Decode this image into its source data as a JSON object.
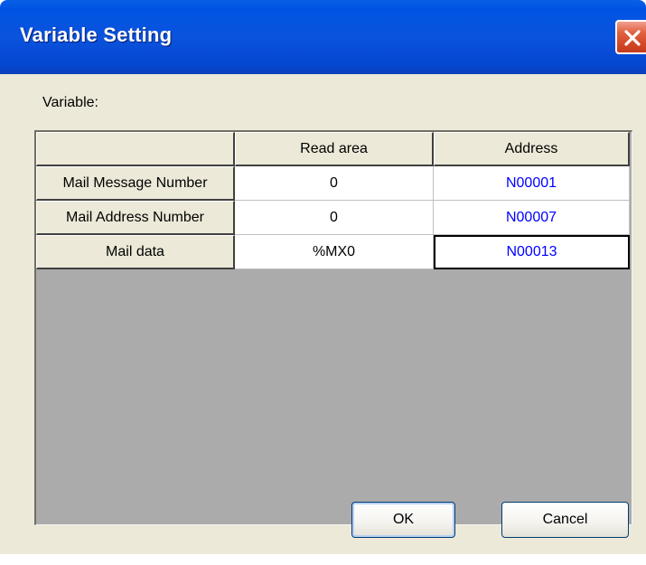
{
  "window": {
    "title": "Variable Setting"
  },
  "variable_label": "Variable:",
  "table": {
    "columns": [
      "",
      "Read area",
      "Address"
    ],
    "rows": [
      {
        "name": "Mail Message Number",
        "read_area": "0",
        "address": "N00001"
      },
      {
        "name": "Mail Address Number",
        "read_area": "0",
        "address": "N00007"
      },
      {
        "name": "Mail data",
        "read_area": "%MX0",
        "address": "N00013"
      }
    ],
    "address_color": "#0000ff"
  },
  "buttons": {
    "ok_label": "OK",
    "cancel_label": "Cancel"
  },
  "colors": {
    "titlebar": "#0054e3",
    "close_button": "#d24a2a",
    "dialog_background": "#ece9d8",
    "grid_background": "#ababab"
  },
  "icons": {
    "close": "close-x-icon"
  }
}
